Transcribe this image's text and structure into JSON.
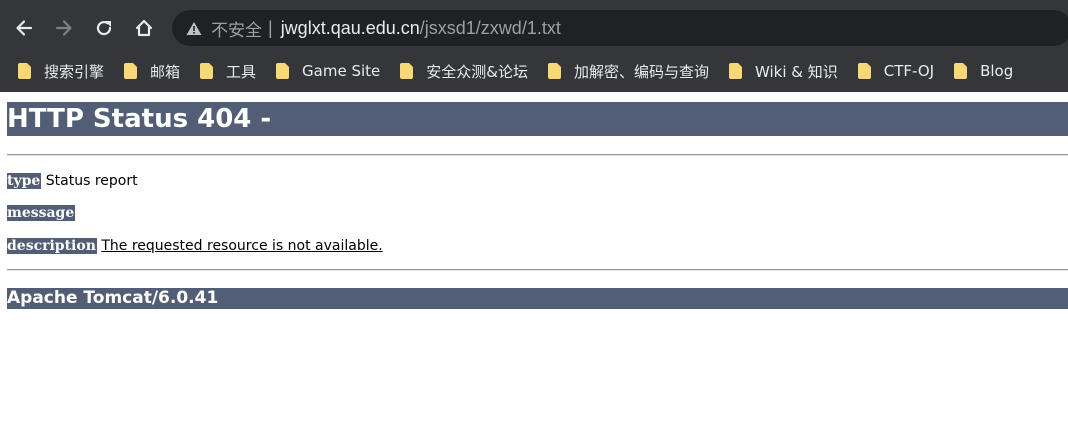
{
  "browser": {
    "security_label": "不安全",
    "security_divider": "|",
    "url_host": "jwglxt.qau.edu.cn",
    "url_path": "/jsxsd1/zxwd/1.txt",
    "bookmarks": [
      {
        "label": "搜索引擎",
        "icon": "folder-icon"
      },
      {
        "label": "邮箱",
        "icon": "folder-icon"
      },
      {
        "label": "工具",
        "icon": "folder-icon"
      },
      {
        "label": "Game Site",
        "icon": "folder-icon"
      },
      {
        "label": "安全众测&论坛",
        "icon": "folder-icon"
      },
      {
        "label": "加解密、编码与查询",
        "icon": "folder-icon"
      },
      {
        "label": "Wiki & 知识",
        "icon": "folder-icon"
      },
      {
        "label": "CTF-OJ",
        "icon": "folder-icon"
      },
      {
        "label": "Blog",
        "icon": "folder-icon"
      }
    ],
    "colors": {
      "chrome_bg": "#35363a",
      "omnibox_bg": "#202124",
      "folder_yellow": "#f8d775"
    }
  },
  "page": {
    "title": "HTTP Status 404 -",
    "type_label": "type",
    "type_value": "Status report",
    "message_label": "message",
    "message_value": "",
    "description_label": "description",
    "description_value": "The requested resource is not available.",
    "server": "Apache Tomcat/6.0.41",
    "colors": {
      "heading_bg": "#525d76",
      "heading_text": "#ffffff"
    }
  }
}
